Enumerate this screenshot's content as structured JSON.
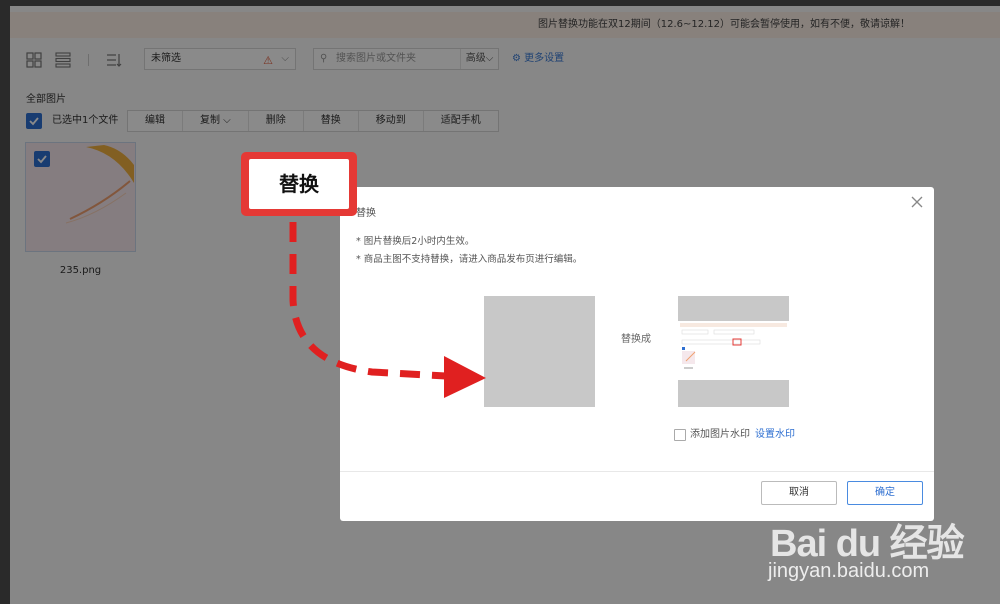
{
  "notice": "图片替换功能在双12期间（12.6~12.12）可能会暂停使用，如有不便，敬请谅解！",
  "toolbar": {
    "filter_value": "未筛选",
    "search_placeholder": "搜索图片或文件夹",
    "advanced_label": "高级",
    "more_settings": "更多设置"
  },
  "section_title": "全部图片",
  "selection": {
    "selected_text": "已选中1个文件",
    "actions": [
      "编辑",
      "复制",
      "删除",
      "替换",
      "移动到",
      "适配手机"
    ]
  },
  "file": {
    "name": "235.png"
  },
  "callout": "替换",
  "modal": {
    "title": "替换",
    "notes": [
      "* 图片替换后2小时内生效。",
      "* 商品主图不支持替换，请进入商品发布页进行编辑。"
    ],
    "replace_with": "替换成",
    "watermark_checkbox": "添加图片水印",
    "watermark_link": "设置水印",
    "cancel": "取消",
    "confirm": "确定"
  },
  "watermark": {
    "logo": "Bai du 经验",
    "url": "jingyan.baidu.com"
  },
  "colors": {
    "accent": "#2e6fd1",
    "callout_red": "#e53935",
    "notice_bg": "#fbefe6"
  }
}
